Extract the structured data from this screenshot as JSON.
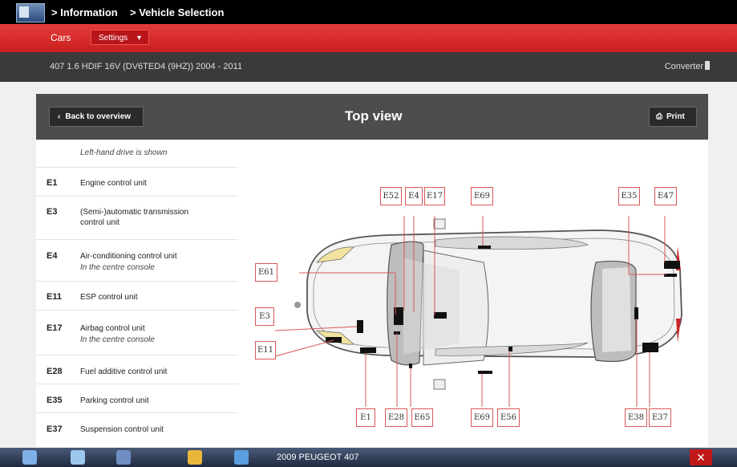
{
  "header": {
    "crumbs": [
      "> Information",
      "> Vehicle Selection"
    ]
  },
  "nav": {
    "cars": "Cars",
    "settings": "Settings"
  },
  "vehicle": {
    "description": "407 1.6 HDIF 16V (DV6TED4 (9HZ)) 2004 - 2011",
    "converter": "Converter"
  },
  "panel": {
    "back": "Back to overview",
    "title": "Top view",
    "print": "Print"
  },
  "list": {
    "intro": "Left-hand drive is shown",
    "items": [
      {
        "code": "E1",
        "desc": "Engine control unit",
        "note": ""
      },
      {
        "code": "E3",
        "desc": "(Semi-)automatic transmission control unit",
        "note": ""
      },
      {
        "code": "E4",
        "desc": "Air-conditioning control unit",
        "note": "In the centre console"
      },
      {
        "code": "E11",
        "desc": "ESP control unit",
        "note": ""
      },
      {
        "code": "E17",
        "desc": "Airbag control unit",
        "note": "In the centre console"
      },
      {
        "code": "E28",
        "desc": "Fuel additive control unit",
        "note": ""
      },
      {
        "code": "E35",
        "desc": "Parking control unit",
        "note": ""
      },
      {
        "code": "E37",
        "desc": "Suspension control unit",
        "note": ""
      }
    ]
  },
  "diagram": {
    "labels": [
      "E52",
      "E4",
      "E17",
      "E69",
      "E35",
      "E47",
      "E61",
      "E3",
      "E11",
      "E1",
      "E28",
      "E65",
      "E69",
      "E56",
      "E38",
      "E37"
    ]
  },
  "taskbar": {
    "title": "2009 PEUGEOT 407"
  },
  "colors": {
    "accent_red": "#d62a2a",
    "label_border": "#d95858"
  }
}
